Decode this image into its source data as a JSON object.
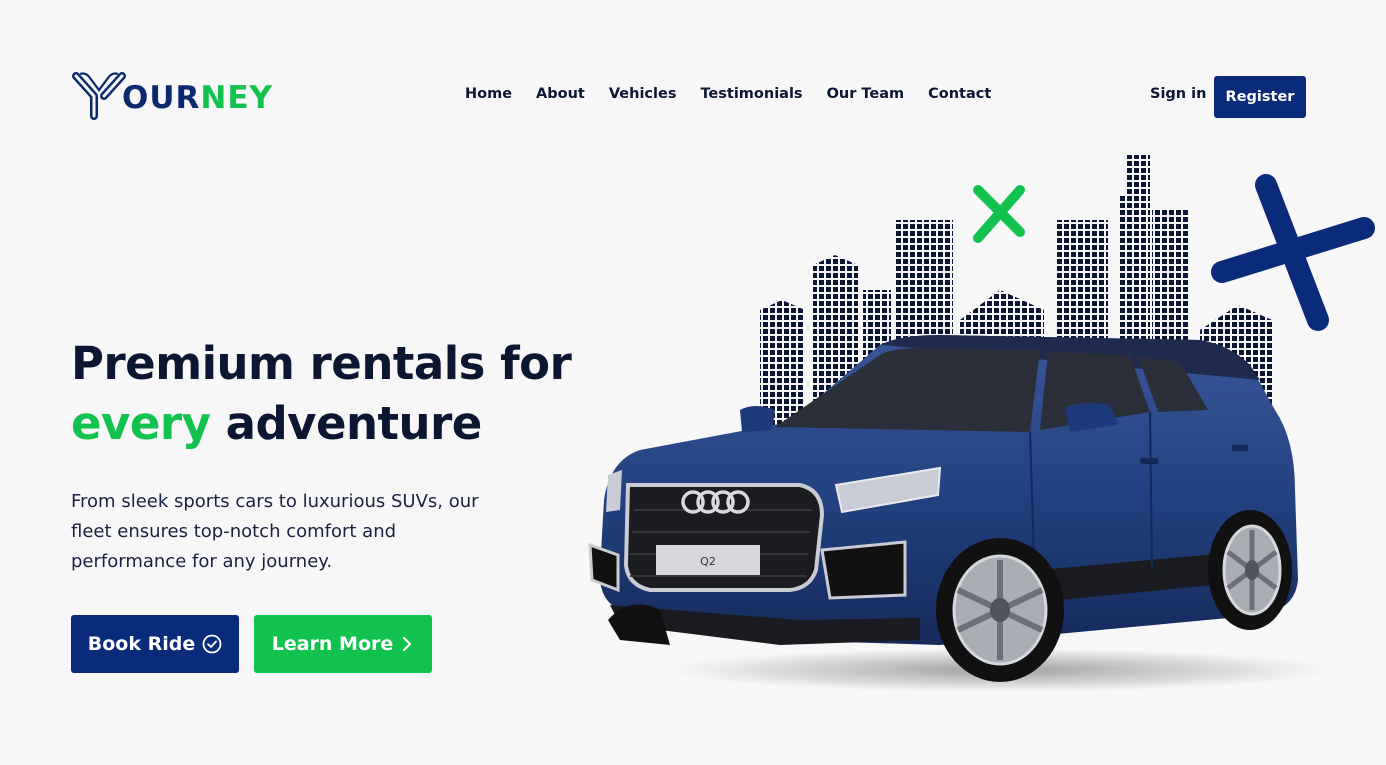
{
  "brand": {
    "logo_part1": "OUR",
    "logo_part2": "NEY"
  },
  "nav": {
    "items": [
      {
        "label": "Home"
      },
      {
        "label": "About"
      },
      {
        "label": "Vehicles"
      },
      {
        "label": "Testimonials"
      },
      {
        "label": "Our Team"
      },
      {
        "label": "Contact"
      }
    ]
  },
  "auth": {
    "signin_label": "Sign in",
    "register_label": "Register"
  },
  "hero": {
    "headline_line1": "Premium rentals for",
    "headline_highlight": "every",
    "headline_rest": " adventure",
    "description": "From sleek sports cars to luxurious SUVs, our fleet ensures top-notch comfort and performance for any journey.",
    "book_label": "Book Ride",
    "learn_label": "Learn More",
    "plate_text": "Q2"
  },
  "colors": {
    "primary": "#0a2a7a",
    "accent": "#12c24f",
    "text": "#0c1633",
    "background": "#f7f7f7"
  },
  "icons": {
    "book": "check-circle-icon",
    "learn": "chevron-right-icon"
  }
}
